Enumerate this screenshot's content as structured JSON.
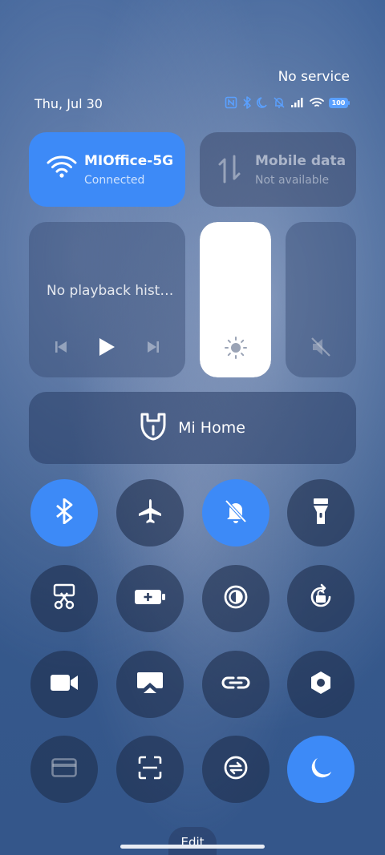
{
  "status": {
    "carrier": "No service",
    "date": "Thu, Jul 30",
    "battery": "100"
  },
  "wifi": {
    "name": "MIOffice-5G",
    "status": "Connected",
    "icon": "wifi-icon"
  },
  "mobile_data": {
    "title": "Mobile data",
    "status": "Not available",
    "icon": "mobile-data-icon"
  },
  "media": {
    "text": "No playback hist…"
  },
  "brightness": {
    "level": 1.0
  },
  "mi_home": {
    "label": "Mi Home"
  },
  "toggles": [
    {
      "name": "bluetooth",
      "on": true
    },
    {
      "name": "airplane-mode",
      "on": false
    },
    {
      "name": "mute",
      "on": true
    },
    {
      "name": "flashlight",
      "on": false
    },
    {
      "name": "screenshot",
      "on": false
    },
    {
      "name": "battery-saver",
      "on": false
    },
    {
      "name": "reading-mode",
      "on": false
    },
    {
      "name": "auto-rotate",
      "on": false
    },
    {
      "name": "screen-recorder",
      "on": false
    },
    {
      "name": "cast",
      "on": false
    },
    {
      "name": "link",
      "on": false
    },
    {
      "name": "settings",
      "on": false
    },
    {
      "name": "card",
      "on": false
    },
    {
      "name": "scanner",
      "on": false
    },
    {
      "name": "sync",
      "on": false
    },
    {
      "name": "dark-mode",
      "on": true
    }
  ],
  "edit": {
    "label": "Edit"
  },
  "colors": {
    "accent": "#3d8af7"
  }
}
